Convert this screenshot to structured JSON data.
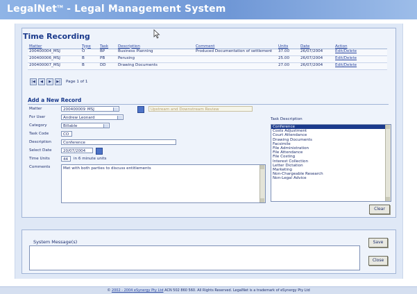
{
  "app": {
    "title_main": "LegalNet",
    "title_tm": "TM",
    "title_rest": " - Legal Management System"
  },
  "section": {
    "title": "Time Recording"
  },
  "table": {
    "headers": [
      "Matter",
      "Type",
      "Task",
      "Description",
      "Comment",
      "Units",
      "Date",
      "Action"
    ],
    "rows": [
      {
        "matter": "200400004_MSJ",
        "type": "O",
        "task": "BP",
        "description": "Business Planning",
        "comment": "Produced Documentation of settlement",
        "units": "37.00",
        "date": "26/07/2004",
        "action": "Edit/Delete"
      },
      {
        "matter": "200400006_MSJ",
        "type": "B",
        "task": "PB",
        "description": "Perusing",
        "comment": "",
        "units": "25.00",
        "date": "26/07/2004",
        "action": "Edit/Delete"
      },
      {
        "matter": "200400007_MSJ",
        "type": "B",
        "task": "DD",
        "description": "Drawing Documents",
        "comment": "",
        "units": "27.00",
        "date": "26/07/2004",
        "action": "Edit/Delete"
      }
    ]
  },
  "pager": {
    "first": "|◀",
    "prev": "◀",
    "next": "▶",
    "last": "▶|",
    "text": "Page 1 of 1"
  },
  "form": {
    "title": "Add a New Record",
    "matter_label": "Matter",
    "matter_value": "200400009_MSJ",
    "matter_desc": "Upstream and Downstream Review",
    "user_label": "For User",
    "user_value": "Andrew Leonard",
    "category_label": "Category",
    "category_value": "Billable",
    "task_code_label": "Task Code",
    "task_code_value": "CO",
    "description_label": "Description",
    "description_value": "Conference",
    "date_label": "Select Date",
    "date_value": "20/07/2004",
    "units_label": "Time Units",
    "units_value": "44",
    "units_hint": "in 6 minute units",
    "comments_label": "Comments",
    "comments_value": "Met with both parties to discuss entitlements",
    "task_desc_label": "Task Description",
    "task_desc_items": [
      "Conference",
      "Costs Adjustment",
      "Court Attendance",
      "Drawing Documents",
      "Facsimile",
      "File Administration",
      "File Attendance",
      "File Costing",
      "Interest Collection",
      "Letter Dictation",
      "Marketing",
      "Non-Chargeable Research",
      "Non-Legal Advice"
    ],
    "clear_label": "Clear"
  },
  "system": {
    "label": "System Message(s)",
    "save_label": "Save",
    "close_label": "Close"
  },
  "footer": {
    "pre": "© ",
    "years": "2002 - 2004",
    "company": " eSynergy Pty Ltd",
    "rest": " ACN 502 860 560. All Rights Reserved. LegalNet is a trademark of eSynergy Pty Ltd"
  },
  "colors": {
    "banner": "#6f97d6",
    "panel": "#eef3fb",
    "heading": "#1a3a8c",
    "selection": "#1a3a8c"
  }
}
